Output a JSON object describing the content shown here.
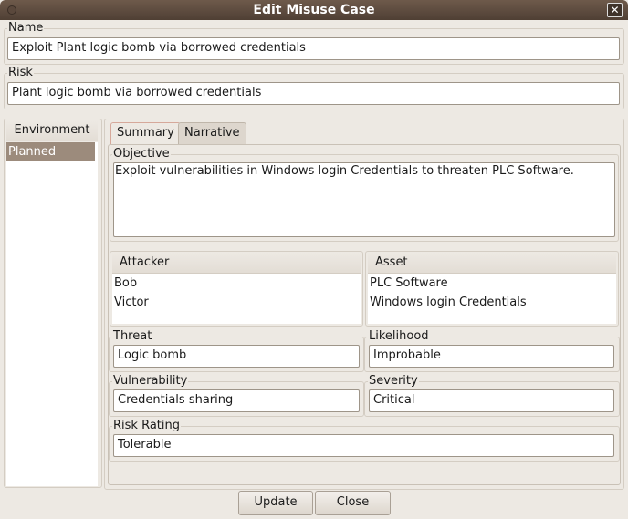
{
  "window": {
    "title": "Edit Misuse Case"
  },
  "name": {
    "label": "Name",
    "value": "Exploit Plant logic bomb via borrowed credentials"
  },
  "risk": {
    "label": "Risk",
    "value": "Plant logic bomb via borrowed credentials"
  },
  "environment": {
    "header": "Environment",
    "items": [
      "Planned"
    ],
    "selected": "Planned"
  },
  "tabs": [
    {
      "label": "Summary",
      "active": true
    },
    {
      "label": "Narrative",
      "active": false
    }
  ],
  "summary": {
    "objective": {
      "label": "Objective",
      "value": "Exploit vulnerabilities in Windows login Credentials to threaten PLC Software."
    },
    "attacker": {
      "header": "Attacker",
      "items": [
        "Bob",
        "Victor"
      ]
    },
    "asset": {
      "header": "Asset",
      "items": [
        "PLC Software",
        "Windows login Credentials"
      ]
    },
    "threat": {
      "label": "Threat",
      "value": "Logic bomb"
    },
    "likelihood": {
      "label": "Likelihood",
      "value": "Improbable"
    },
    "vulnerability": {
      "label": "Vulnerability",
      "value": "Credentials sharing"
    },
    "severity": {
      "label": "Severity",
      "value": "Critical"
    },
    "risk_rating": {
      "label": "Risk Rating",
      "value": "Tolerable"
    }
  },
  "buttons": {
    "update": "Update",
    "close": "Close"
  },
  "colors": {
    "titlebar": "#5a483c",
    "selection": "#9c8b7c",
    "background": "#ede9e3"
  }
}
